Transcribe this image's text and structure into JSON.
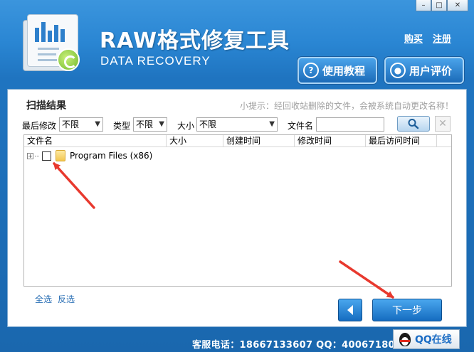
{
  "window": {
    "controls": [
      "–",
      "□",
      "✕"
    ]
  },
  "header": {
    "title": "RAW格式修复工具",
    "subtitle": "DATA RECOVERY",
    "links": {
      "buy": "购买",
      "register": "注册"
    },
    "buttons": {
      "tutorial": "使用教程",
      "review": "用户评价"
    }
  },
  "scan": {
    "title": "扫描结果",
    "tip": "小提示：经回收站删除的文件，会被系统自动更改名称！"
  },
  "filters": {
    "last_modified_label": "最后修改",
    "last_modified_value": "不限",
    "type_label": "类型",
    "type_value": "不限",
    "size_label": "大小",
    "size_value": "不限",
    "filename_label": "文件名",
    "filename_value": ""
  },
  "list": {
    "columns": [
      "文件名",
      "大小",
      "创建时间",
      "修改时间",
      "最后访问时间"
    ],
    "rows": [
      {
        "name": "Program Files (x86)"
      }
    ]
  },
  "selection": {
    "select_all": "全选",
    "invert": "反选"
  },
  "nav": {
    "next": "下一步"
  },
  "footer": {
    "service": "客服电话：18667133607 QQ：4006718068",
    "qq_label": "QQ在线"
  },
  "colors": {
    "accent": "#1f74c0",
    "annotation": "#e8392e",
    "link": "#2a6fb5"
  }
}
